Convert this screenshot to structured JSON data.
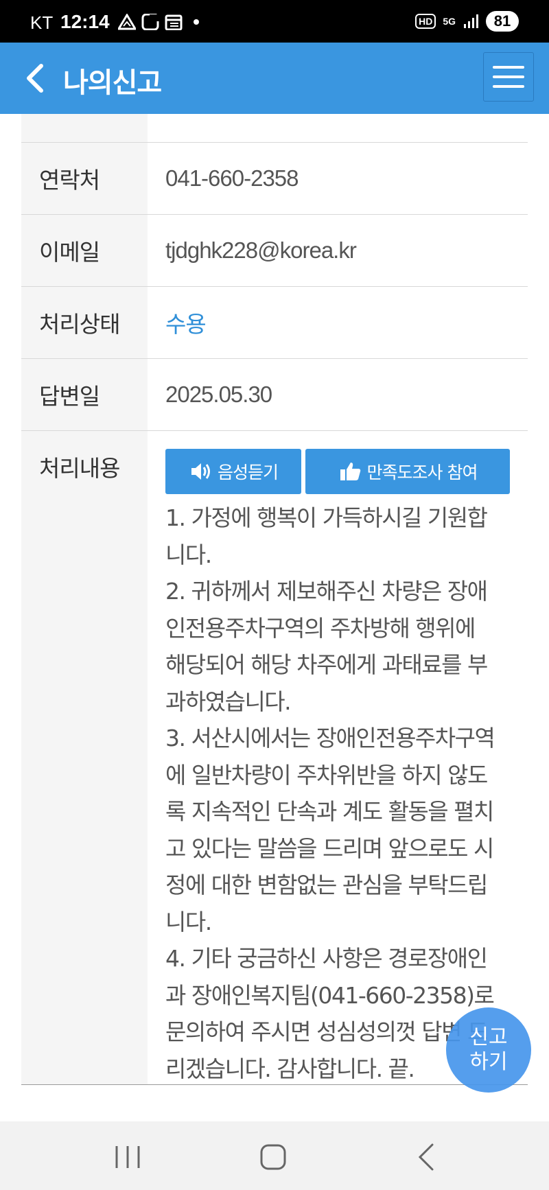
{
  "status_bar": {
    "carrier": "KT",
    "time": "12:14",
    "network_hd": "HD",
    "network_5g": "5G",
    "battery": "81",
    "icons": [
      "warning-icon",
      "app-c-icon",
      "calendar-icon",
      "dot-icon",
      "signal-icon"
    ]
  },
  "header": {
    "title": "나의신고",
    "back_icon": "chevron-left-icon",
    "menu_icon": "hamburger-icon",
    "bg_color": "#3a96e0"
  },
  "rows": [
    {
      "label": "연락처",
      "value": "041-660-2358"
    },
    {
      "label": "이메일",
      "value": "tjdghk228@korea.kr"
    },
    {
      "label": "처리상태",
      "value": "수용"
    },
    {
      "label": "답변일",
      "value": "2025.05.30"
    }
  ],
  "detail": {
    "label": "처리내용",
    "voice_button": "음성듣기",
    "survey_button": "만족도조사 참여",
    "lines": [
      "1. 가정에 행복이 가득하시길 기원합",
      "니다.",
      "2. 귀하께서 제보해주신 차량은 장애",
      "인전용주차구역의 주차방해 행위에",
      "해당되어 해당 차주에게 과태료를 부",
      "과하였습니다.",
      "3. 서산시에서는 장애인전용주차구역",
      "에 일반차량이 주차위반을 하지 않도",
      "록 지속적인 단속과 계도 활동을 펼치",
      "고 있다는 말씀을 드리며 앞으로도 시",
      "정에 대한 변함없는 관심을 부탁드립",
      "니다.",
      "4. 기타 궁금하신 사항은 경로장애인",
      "과 장애인복지팀(041-660-2358)로",
      "문의하여 주시면 성심성의껏 답변 드",
      "리겠습니다. 감사합니다. 끝."
    ]
  },
  "fab": {
    "line1": "신고",
    "line2": "하기"
  },
  "status_color": "#2f8fd8",
  "nav": [
    "recent-apps-icon",
    "home-icon",
    "back-icon"
  ]
}
